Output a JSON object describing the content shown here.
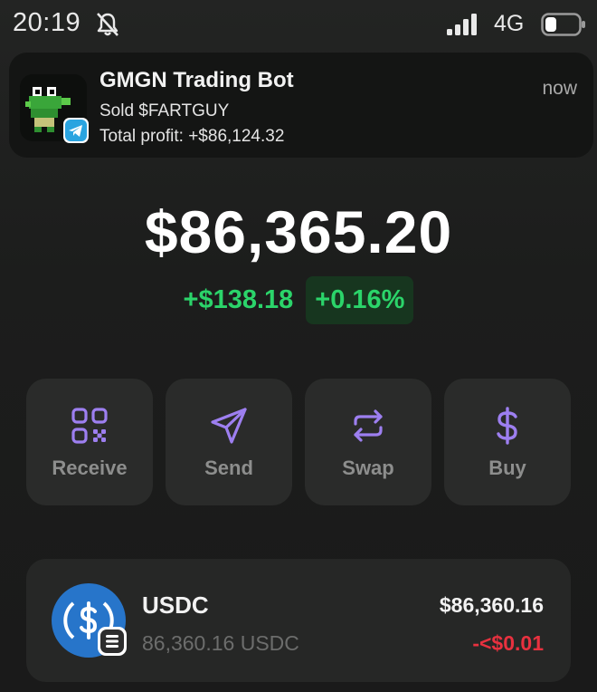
{
  "status_bar": {
    "time": "20:19",
    "network": "4G",
    "icons": [
      "mute-icon",
      "signal-icon",
      "battery-icon"
    ]
  },
  "notification": {
    "title": "GMGN Trading Bot",
    "line1": "Sold $FARTGUY",
    "line2": "Total profit: +$86,124.32",
    "time": "now",
    "icons": [
      "bot-avatar",
      "telegram-icon"
    ]
  },
  "wallet": {
    "balance": "$86,365.20",
    "change_amount": "+$138.18",
    "change_percent": "+0.16%"
  },
  "actions": [
    {
      "label": "Receive",
      "icon": "qr-code-icon"
    },
    {
      "label": "Send",
      "icon": "send-arrow-icon"
    },
    {
      "label": "Swap",
      "icon": "swap-arrows-icon"
    },
    {
      "label": "Buy",
      "icon": "dollar-icon"
    }
  ],
  "tokens": [
    {
      "symbol": "USDC",
      "amount": "86,360.16 USDC",
      "value": "$86,360.16",
      "change": "-<$0.01",
      "icons": [
        "usdc-icon",
        "chain-badge-icon"
      ]
    }
  ],
  "colors": {
    "background": "#1d1e1d",
    "accent_purple": "#9d7ff0",
    "positive_green": "#2bd46a",
    "negative_red": "#e8313f",
    "usdc_blue": "#2775ca"
  }
}
